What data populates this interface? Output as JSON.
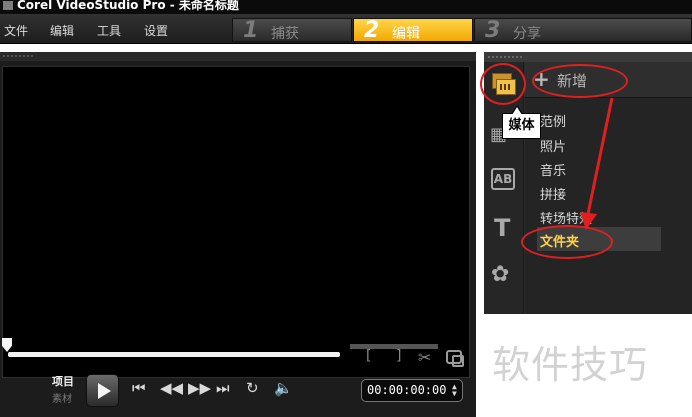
{
  "window": {
    "title": "Corel VideoStudio Pro - 未命名标题"
  },
  "menu": [
    "文件",
    "编辑",
    "工具",
    "设置"
  ],
  "steps": [
    {
      "num": "1",
      "label": "捕获"
    },
    {
      "num": "2",
      "label": "编辑"
    },
    {
      "num": "3",
      "label": "分享"
    }
  ],
  "preview": {
    "mode_project": "项目",
    "mode_clip": "素材",
    "bracket_in": "[",
    "bracket_out": "]",
    "timecode": "00:00:00:00"
  },
  "library": {
    "add_label": "新增",
    "tooltip": "媒体",
    "categories": [
      "范例",
      "照片",
      "音乐",
      "拼接",
      "转场特效",
      "文件夹"
    ],
    "selected_index": 5
  },
  "annotation_color": "#e02020",
  "accent": "#f5b700",
  "watermark": "软件技巧"
}
